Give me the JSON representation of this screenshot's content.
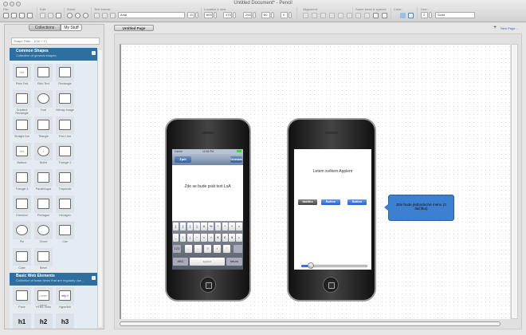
{
  "window": {
    "title": "Untitled Document* - Pencil"
  },
  "toolbar": {
    "groups": {
      "file": "File:",
      "edit": "Edit:",
      "zoom": "Zoom:",
      "text_format": "Text format:",
      "location_size": "Location & size:",
      "alignment": "Alignment:",
      "same_sizes": "Same sizes & spaces:",
      "color": "Color:",
      "line": "Line:"
    },
    "font": "Arial",
    "font_size": "11",
    "x": "809",
    "y": "475",
    "width": "200",
    "height": "80",
    "angle": "0",
    "line_width": "2",
    "line_style": "Solid",
    "fill_color": "#9bbde6",
    "stroke_color": "#5a7fb0"
  },
  "sidebar": {
    "tabs": [
      "Collections",
      "My Stuff"
    ],
    "filter_placeholder": "Shape Filter... (Ctrl + F)",
    "sections": [
      {
        "title": "Common Shapes",
        "subtitle": "Collection of general shapes",
        "items": [
          "Plain Text",
          "Rich Text",
          "Rectangle",
          "Gradient Rectangle",
          "Oval",
          "Bitmap Image",
          "Straight line",
          "Triangle",
          "Free Line",
          "Balloon",
          "Bullet",
          "Triangle 2",
          "Triangle 3",
          "Parallelogra",
          "Trapezoid",
          "Diamond",
          "Pentagon",
          "Hexagon",
          "Pie",
          "Chord",
          "Can",
          "Cube",
          "Bevel"
        ]
      },
      {
        "title": "Basic Web Elements",
        "subtitle": "Collection of basic items that are regularly use...",
        "items": [
          "Pane",
          "HTML Texts",
          "Hyperlink",
          "h1",
          "h2",
          "h3"
        ]
      }
    ],
    "icon_texts": {
      "abc": "Abc",
      "lorem": "Lorem ipsum",
      "link": "http://",
      "bullet": "1"
    }
  },
  "page": {
    "tab": "Untitled Page",
    "new_page": "New Page..."
  },
  "phone1": {
    "carrier": "Carrier",
    "time": "12:34 PM",
    "back": "Zpět",
    "send": "Odeslat",
    "text": "Zde se bude psát text LsA",
    "keys_row1": [
      "[",
      "]",
      "{",
      "}",
      "#",
      "%",
      "^",
      "*",
      "+",
      "="
    ],
    "keys_row2": [
      "_",
      "\\",
      "|",
      "~",
      "<",
      ">",
      "€",
      "£",
      "¥",
      "•"
    ],
    "keys_row3": [
      "123",
      ".",
      ",",
      "?",
      "!",
      "'"
    ],
    "abc": "ABC",
    "space": "space",
    "return": "return"
  },
  "phone2": {
    "title": "Letem světem Applem",
    "buttons": [
      "tlačítko",
      "Button",
      "Button"
    ],
    "slider_value": 0.15
  },
  "callout": {
    "text": "Zde bude jednoduché menu (3 tlačítka)"
  }
}
